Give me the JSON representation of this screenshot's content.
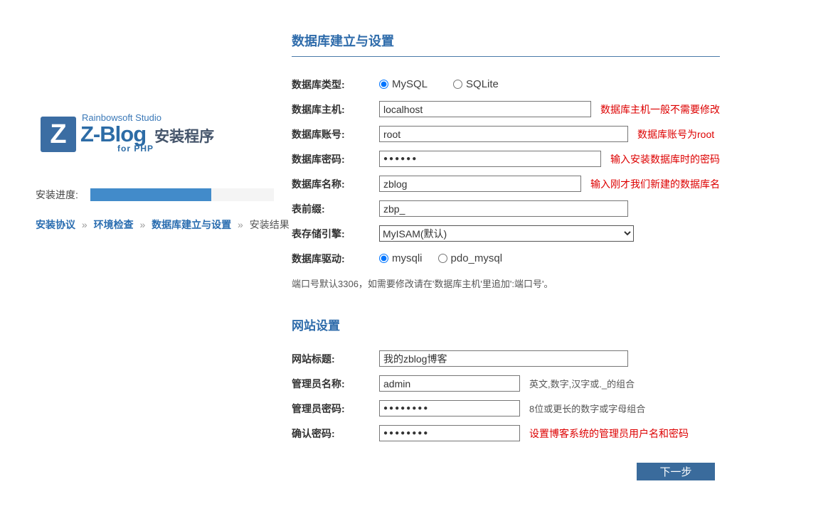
{
  "logo": {
    "letter": "Z",
    "studio": "Rainbowsoft Studio",
    "brand": "Z-Blog",
    "sub": "for PHP",
    "app": "安装程序"
  },
  "progress": {
    "label": "安装进度:",
    "percent": 66
  },
  "breadcrumb": {
    "separator": "»",
    "items": [
      {
        "label": "安装协议"
      },
      {
        "label": "环境检查"
      },
      {
        "label": "数据库建立与设置"
      },
      {
        "label": "安装结果"
      }
    ]
  },
  "database": {
    "title": "数据库建立与设置",
    "type_label": "数据库类型:",
    "type_options": [
      {
        "label": "MySQL",
        "selected": true
      },
      {
        "label": "SQLite",
        "selected": false
      }
    ],
    "fields": [
      {
        "label": "数据库主机:",
        "value": "localhost",
        "hint": "数据库主机一般不需要修改"
      },
      {
        "label": "数据库账号:",
        "value": "root",
        "hint": "数据库账号为root"
      },
      {
        "label": "数据库密码:",
        "value": "●●●●●●",
        "hint": "输入安装数据库时的密码"
      },
      {
        "label": "数据库名称:",
        "value": "zblog",
        "hint": "输入刚才我们新建的数据库名"
      },
      {
        "label": "表前缀:",
        "value": "zbp_",
        "hint": ""
      }
    ],
    "engine_label": "表存储引擎:",
    "engine_value": "MyISAM(默认)",
    "driver_label": "数据库驱动:",
    "driver_options": [
      {
        "label": "mysqli",
        "selected": true
      },
      {
        "label": "pdo_mysql",
        "selected": false
      }
    ],
    "note": "端口号默认3306，如需要修改请在'数据库主机'里追加':端口号'。"
  },
  "site": {
    "title": "网站设置",
    "fields": [
      {
        "label": "网站标题:",
        "value": "我的zblog博客",
        "hint": ""
      },
      {
        "label": "管理员名称:",
        "value": "admin",
        "hint": "英文,数字,汉字或._的组合"
      },
      {
        "label": "管理员密码:",
        "value": "●●●●●●●●",
        "hint": "8位或更长的数字或字母组合"
      },
      {
        "label": "确认密码:",
        "value": "●●●●●●●●",
        "hint": "设置博客系统的管理员用户名和密码"
      }
    ]
  },
  "button": {
    "next": "下一步"
  },
  "colors": {
    "accent_blue": "#2f6cab",
    "progress_fill": "#428bca",
    "hint_red": "#dd0000",
    "button_bg": "#3a6b9c"
  }
}
